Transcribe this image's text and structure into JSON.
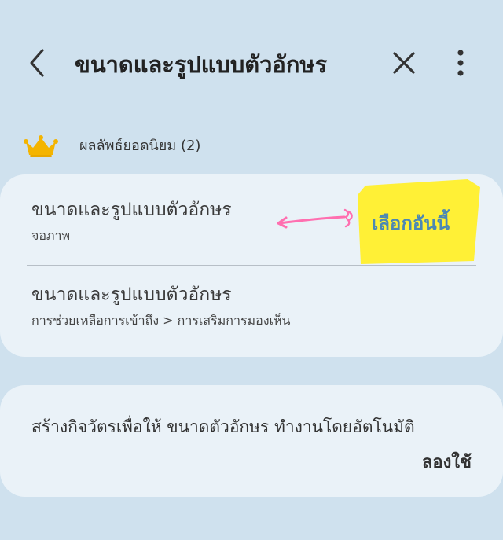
{
  "header": {
    "title": "ขนาดและรูปแบบตัวอักษร",
    "back_icon": "back-chevron-icon",
    "close_icon": "close-icon",
    "more_icon": "more-vertical-icon"
  },
  "section": {
    "label": "ผลลัพธ์ยอดนิยม (2)",
    "icon": "crown-icon",
    "icon_color": "#f4b400"
  },
  "results": [
    {
      "title": "ขนาดและรูปแบบตัวอักษร",
      "subtitle": "จอภาพ"
    },
    {
      "title": "ขนาดและรูปแบบตัวอักษร",
      "subtitle": "การช่วยเหลือการเข้าถึง > การเสริมการมองเห็น"
    }
  ],
  "annotation": {
    "text": "เลือกอันนี้",
    "arrow_color": "#ff6fb0",
    "highlight_color": "#ffef2f",
    "text_color": "#4c88b3"
  },
  "routine": {
    "text": "สร้างกิจวัตรเพื่อให้ ขนาดตัวอักษร ทำงานโดยอัตโนมัติ",
    "action": "ลองใช้"
  }
}
